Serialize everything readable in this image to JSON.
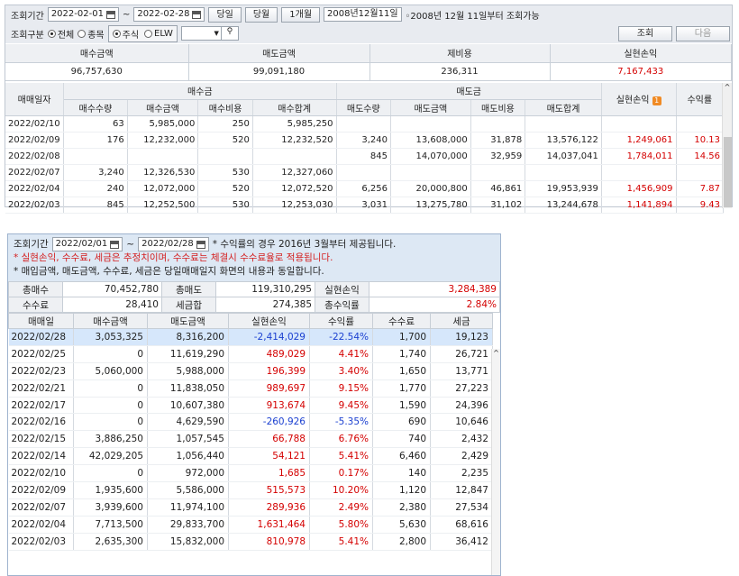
{
  "top": {
    "row1": {
      "label": "조회기간",
      "from": "2022-02-01",
      "tilde": "~",
      "to": "2022-02-28",
      "btn_today": "당일",
      "btn_month": "당월",
      "btn_1m": "1개월",
      "date_box": "2008년12월11일",
      "note": "◦2008년 12월 11일부터 조회가능",
      "btn_query": "조회",
      "btn_next": "다음"
    },
    "row2": {
      "label": "조회구분",
      "opt_all": "전체",
      "opt_item": "종목",
      "opt_stock": "주식",
      "opt_etf": "ELW"
    },
    "summary": {
      "headers": [
        "매수금액",
        "매도금액",
        "제비용",
        "실현손익"
      ],
      "values": [
        "96,757,630",
        "99,091,180",
        "236,311",
        "7,167,433"
      ]
    },
    "table": {
      "col_date": "매매일자",
      "grp_buy": "매수금",
      "grp_sell": "매도금",
      "col_pnl": "실현손익",
      "badge": "1",
      "col_rate": "수익률",
      "subcols": [
        "매수수량",
        "매수금액",
        "매수비용",
        "매수합계",
        "매도수량",
        "매도금액",
        "매도비용",
        "매도합계"
      ],
      "rows": [
        [
          "2022/02/10",
          "63",
          "5,985,000",
          "250",
          "5,985,250",
          "",
          "",
          "",
          "",
          "",
          ""
        ],
        [
          "2022/02/09",
          "176",
          "12,232,000",
          "520",
          "12,232,520",
          "3,240",
          "13,608,000",
          "31,878",
          "13,576,122",
          "1,249,061",
          "10.13"
        ],
        [
          "2022/02/08",
          "",
          "",
          "",
          "",
          "845",
          "14,070,000",
          "32,959",
          "14,037,041",
          "1,784,011",
          "14.56"
        ],
        [
          "2022/02/07",
          "3,240",
          "12,326,530",
          "530",
          "12,327,060",
          "",
          "",
          "",
          "",
          "",
          ""
        ],
        [
          "2022/02/04",
          "240",
          "12,072,000",
          "520",
          "12,072,520",
          "6,256",
          "20,000,800",
          "46,861",
          "19,953,939",
          "1,456,909",
          "7.87"
        ],
        [
          "2022/02/03",
          "845",
          "12,252,500",
          "530",
          "12,253,030",
          "3,031",
          "13,275,780",
          "31,102",
          "13,244,678",
          "1,141,894",
          "9.43"
        ]
      ]
    }
  },
  "bottom": {
    "period_label": "조회기간",
    "from": "2022/02/01",
    "tilde": "~",
    "to": "2022/02/28",
    "note1": "* 수익률의 경우 2016년 3월부터 제공됩니다.",
    "note2": "* 실현손익, 수수료, 세금은 추정치이며, 수수료는 체결시 수수료율로 적용됩니다.",
    "note3": "* 매입금액, 매도금액, 수수료, 세금은 당일매매일지 화면의 내용과 동일합니다.",
    "summary": {
      "buy_total_label": "총매수",
      "buy_total": "70,452,780",
      "sell_total_label": "총매도",
      "sell_total": "119,310,295",
      "pnl_label": "실현손익",
      "pnl": "3,284,389",
      "fee_label": "수수료",
      "fee": "28,410",
      "tax_label": "세금합",
      "tax": "274,385",
      "rate_label": "총수익률",
      "rate": "2.84%"
    },
    "headers": [
      "매매일",
      "매수금액",
      "매도금액",
      "실현손익",
      "수익률",
      "수수료",
      "세금"
    ],
    "rows": [
      [
        "2022/02/28",
        "3,053,325",
        "8,316,200",
        "-2,414,029",
        "-22.54%",
        "1,700",
        "19,123"
      ],
      [
        "2022/02/25",
        "0",
        "11,619,290",
        "489,029",
        "4.41%",
        "1,740",
        "26,721"
      ],
      [
        "2022/02/23",
        "5,060,000",
        "5,988,000",
        "196,399",
        "3.40%",
        "1,650",
        "13,771"
      ],
      [
        "2022/02/21",
        "0",
        "11,838,050",
        "989,697",
        "9.15%",
        "1,770",
        "27,223"
      ],
      [
        "2022/02/17",
        "0",
        "10,607,380",
        "913,674",
        "9.45%",
        "1,590",
        "24,396"
      ],
      [
        "2022/02/16",
        "0",
        "4,629,590",
        "-260,926",
        "-5.35%",
        "690",
        "10,646"
      ],
      [
        "2022/02/15",
        "3,886,250",
        "1,057,545",
        "66,788",
        "6.76%",
        "740",
        "2,432"
      ],
      [
        "2022/02/14",
        "42,029,205",
        "1,056,440",
        "54,121",
        "5.41%",
        "6,460",
        "2,429"
      ],
      [
        "2022/02/10",
        "0",
        "972,000",
        "1,685",
        "0.17%",
        "140",
        "2,235"
      ],
      [
        "2022/02/09",
        "1,935,600",
        "5,586,000",
        "515,573",
        "10.20%",
        "1,120",
        "12,847"
      ],
      [
        "2022/02/07",
        "3,939,600",
        "11,974,100",
        "289,936",
        "2.49%",
        "2,380",
        "27,534"
      ],
      [
        "2022/02/04",
        "7,713,500",
        "29,833,700",
        "1,631,464",
        "5.80%",
        "5,630",
        "68,616"
      ],
      [
        "2022/02/03",
        "2,635,300",
        "15,832,000",
        "810,978",
        "5.41%",
        "2,800",
        "36,412"
      ]
    ]
  }
}
